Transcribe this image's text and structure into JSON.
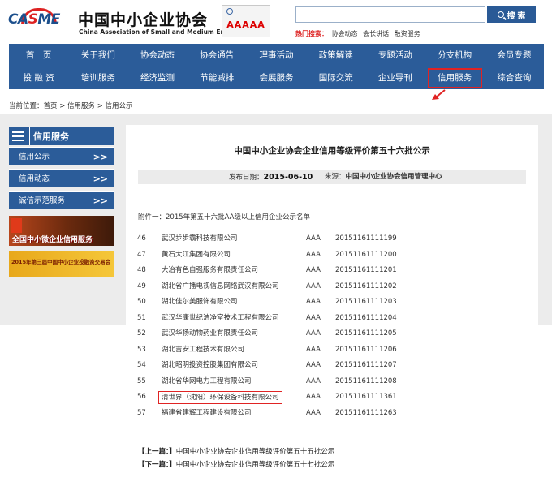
{
  "header": {
    "logo_text_main": "CA",
    "logo_text_accent": "S",
    "logo_text_end": "ME",
    "org_name_cn": "中国中小企业协会",
    "org_name_en": "China Association of Small and Medium Enterprises",
    "badge_rating": "AAAAA",
    "search_button": "搜 索",
    "hot_search_label": "热门搜索：",
    "hot_search_terms": [
      "协会动态",
      "会长讲话",
      "融资服务"
    ]
  },
  "nav": {
    "row1": [
      "首　页",
      "关于我们",
      "协会动态",
      "协会通告",
      "理事活动",
      "政策解读",
      "专题活动",
      "分支机构",
      "会员专题"
    ],
    "row2": [
      "投 融 资",
      "培训服务",
      "经济监测",
      "节能减排",
      "会展服务",
      "国际交流",
      "企业导刊",
      "信用服务",
      "综合查询"
    ],
    "highlighted": "信用服务"
  },
  "breadcrumb": {
    "text": "当前位置：首页 > 信用服务 > 信用公示"
  },
  "sidebar": {
    "title": "信用服务",
    "items": [
      {
        "label": "信用公示"
      },
      {
        "label": "信用动态"
      },
      {
        "label": "诚信示范服务"
      }
    ],
    "banner1_text": "全国中小微企业信用服务",
    "banner2_text": "2015年第三届中国中小企业投融资交易会"
  },
  "article": {
    "title": "中国中小企业协会企业信用等级评价第五十六批公示",
    "publish_label": "发布日期：",
    "publish_date": "2015-06-10",
    "source_label": "来源：",
    "source_value": "中国中小企业协会信用管理中心",
    "attachment": "附件一：2015年第五十六批AA级以上信用企业公示名单",
    "rows": [
      {
        "no": "46",
        "name": "武汉步步霸科技有限公司",
        "level": "AAA",
        "code": "20151161111199"
      },
      {
        "no": "47",
        "name": "黄石大江集团有限公司",
        "level": "AAA",
        "code": "20151161111200"
      },
      {
        "no": "48",
        "name": "大冶有色自强服务有限责任公司",
        "level": "AAA",
        "code": "20151161111201"
      },
      {
        "no": "49",
        "name": "湖北省广播电视信息网络武汉有限公司",
        "level": "AAA",
        "code": "20151161111202"
      },
      {
        "no": "50",
        "name": "湖北佳尔美服饰有限公司",
        "level": "AAA",
        "code": "20151161111203"
      },
      {
        "no": "51",
        "name": "武汉华康世纪洁净室技术工程有限公司",
        "level": "AAA",
        "code": "20151161111204"
      },
      {
        "no": "52",
        "name": "武汉华扬动物药业有限责任公司",
        "level": "AAA",
        "code": "20151161111205"
      },
      {
        "no": "53",
        "name": "湖北吉安工程技术有限公司",
        "level": "AAA",
        "code": "20151161111206"
      },
      {
        "no": "54",
        "name": "湖北昭明投资控股集团有限公司",
        "level": "AAA",
        "code": "20151161111207"
      },
      {
        "no": "55",
        "name": "湖北省华网电力工程有限公司",
        "level": "AAA",
        "code": "20151161111208"
      },
      {
        "no": "56",
        "name": "清世界（沈阳）环保设备科技有限公司",
        "level": "AAA",
        "code": "20151161111361"
      },
      {
        "no": "57",
        "name": "福建省建辉工程建设有限公司",
        "level": "AAA",
        "code": "20151161111263"
      }
    ],
    "highlighted_row": "56",
    "prev_label": "【上一篇：】",
    "prev_title": "中国中小企业协会企业信用等级评价第五十五批公示",
    "next_label": "【下一篇：】",
    "next_title": "中国中小企业协会企业信用等级评价第五十七批公示"
  },
  "colors": {
    "nav_blue": "#2b5c99",
    "highlight_red": "#e02323",
    "meta_gray": "#ebebeb"
  }
}
